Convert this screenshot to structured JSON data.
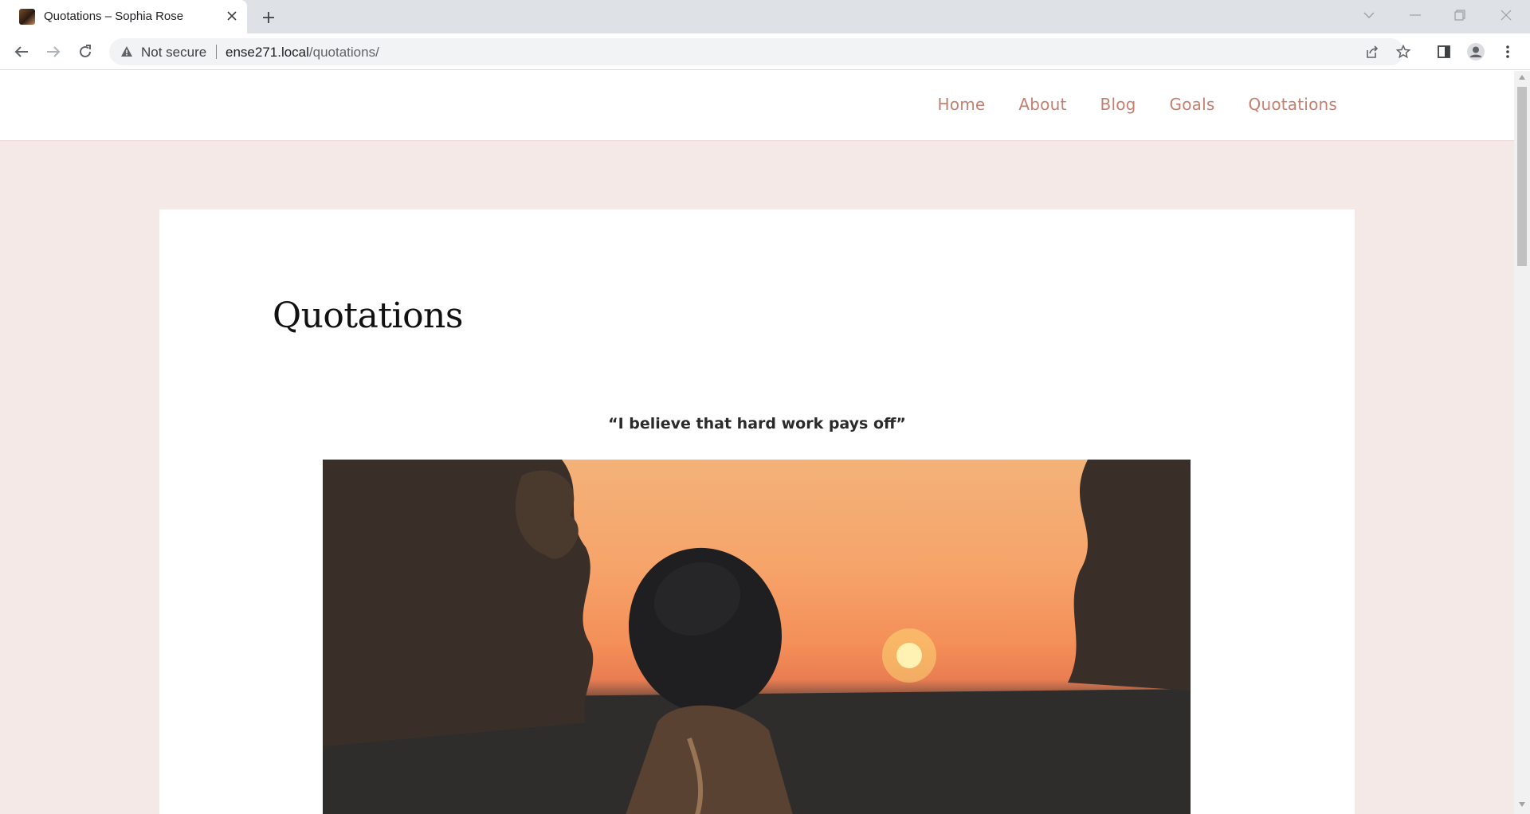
{
  "browser": {
    "tab_title": "Quotations – Sophia Rose",
    "address": {
      "security_label": "Not secure",
      "host": "ense271.local",
      "path": "/quotations/"
    }
  },
  "site": {
    "nav": [
      "Home",
      "About",
      "Blog",
      "Goals",
      "Quotations"
    ]
  },
  "page": {
    "title": "Quotations",
    "quote": "“I believe that hard work pays off”"
  }
}
